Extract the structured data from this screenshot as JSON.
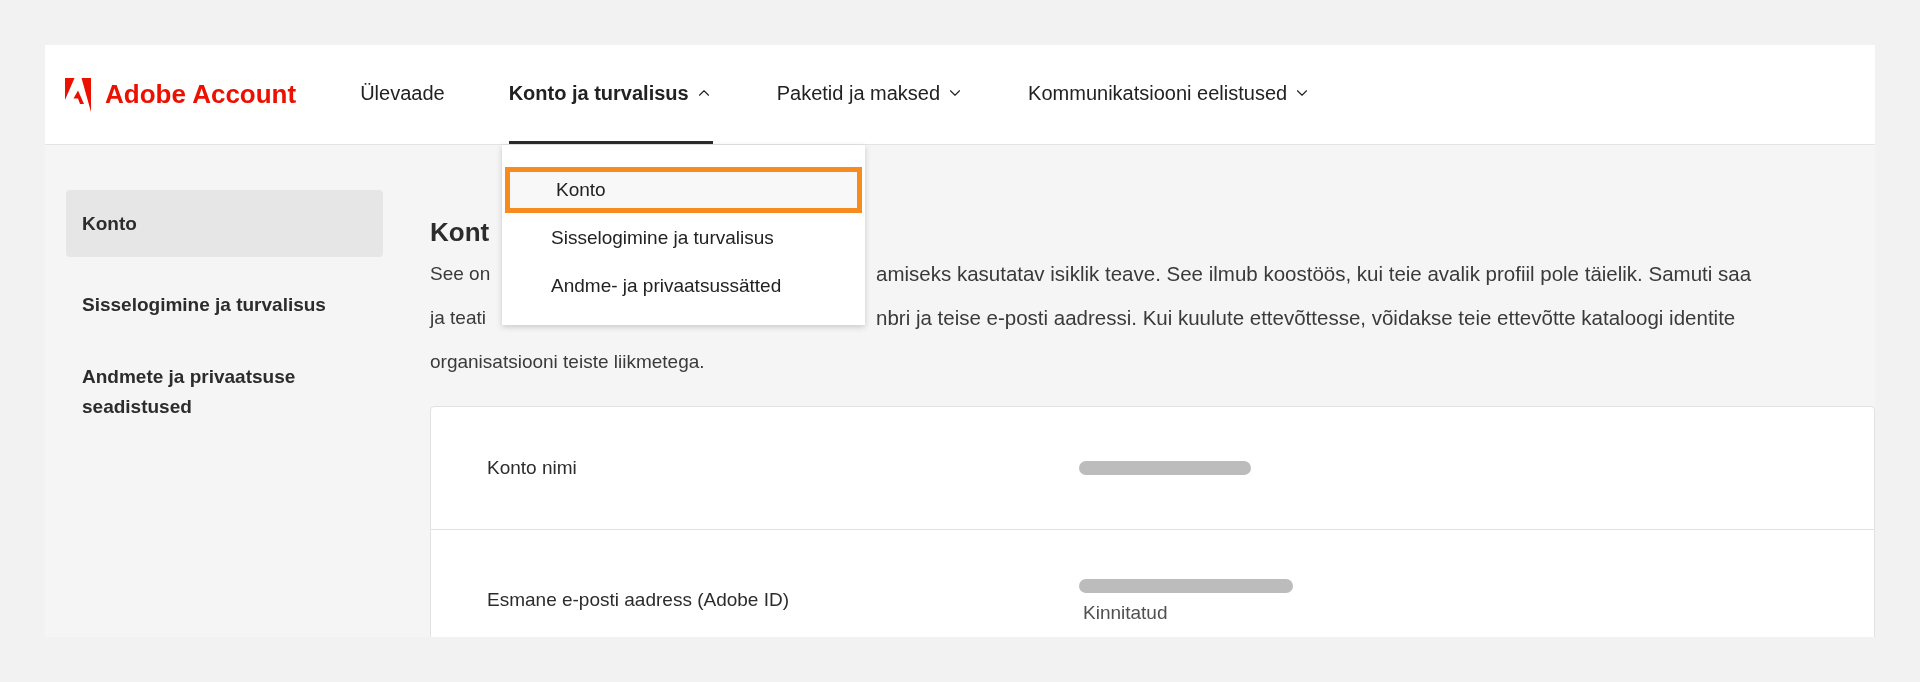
{
  "header": {
    "brand": "Adobe Account",
    "nav": [
      {
        "label": "Ülevaade",
        "selected": false
      },
      {
        "label": "Konto ja turvalisus",
        "selected": true,
        "expanded": true
      },
      {
        "label": "Paketid ja maksed",
        "selected": false,
        "expanded": false
      },
      {
        "label": "Kommunikatsiooni eelistused",
        "selected": false,
        "expanded": false
      }
    ]
  },
  "dropdown": {
    "items": [
      {
        "label": "Konto",
        "selected": true
      },
      {
        "label": "Sisselogimine ja turvalisus",
        "selected": false
      },
      {
        "label": "Andme- ja privaatsussätted",
        "selected": false
      }
    ]
  },
  "sidebar": {
    "items": [
      {
        "label": "Konto",
        "selected": true
      },
      {
        "label": "Sisselogimine ja turvalisus",
        "selected": false
      },
      {
        "label": "Andmete ja privaatsuse seadistused",
        "selected": false
      }
    ]
  },
  "content": {
    "heading": "Kont",
    "paragraph_lines": [
      {
        "left": "See on",
        "right": "amiseks kasutatav isiklik teave. See ilmub koostöös, kui teie avalik profiil pole täielik. Samuti saa"
      },
      {
        "left": "ja teati",
        "right": "nbri ja teise e-posti aadressi. Kui kuulute ettevõttesse, võidakse teie ettevõtte kataloogi identite"
      },
      {
        "left": "organisatsiooni teiste liikmetega."
      }
    ],
    "rows": [
      {
        "label": "Konto nimi",
        "value": {
          "kind": "redacted"
        }
      },
      {
        "label": "Esmane e-posti aadress (Adobe ID)",
        "value": {
          "kind": "redacted",
          "note": "Kinnitatud"
        }
      }
    ]
  }
}
